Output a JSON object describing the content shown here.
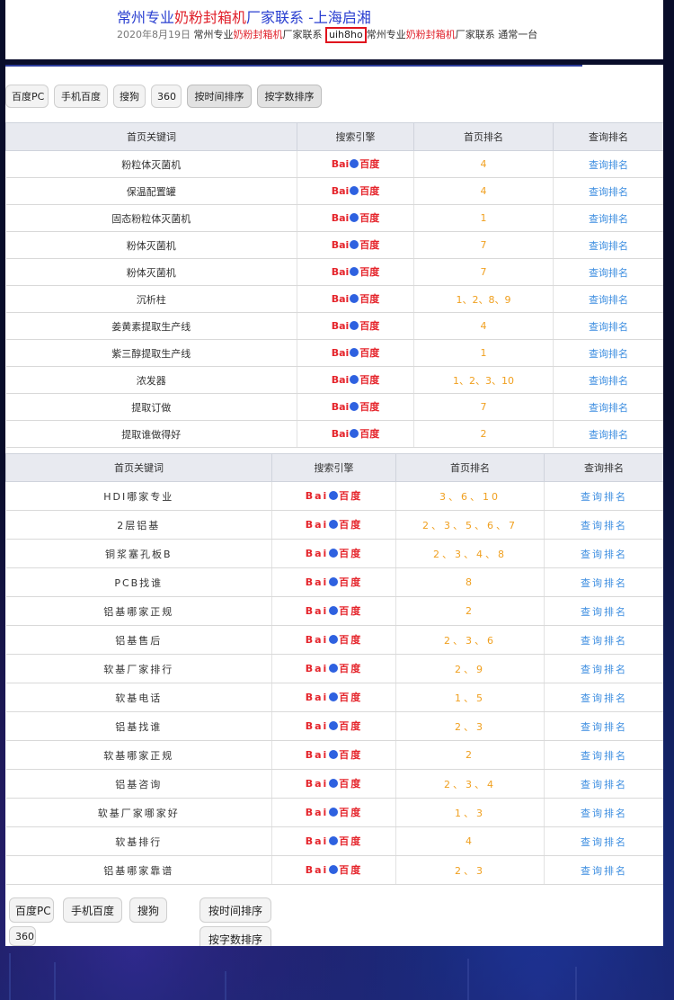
{
  "search_result": {
    "title_prefix": "常州专业",
    "title_highlight": "奶粉封箱机",
    "title_suffix": "厂家联系 -上海启湘",
    "meta_date": "2020年8月19日",
    "meta_part1": "常州专业",
    "meta_hl1": "奶粉封箱机",
    "meta_part2": "厂家联系",
    "meta_code": "uih8ho",
    "meta_part3": "常州专业",
    "meta_hl2": "奶粉封箱机",
    "meta_part4": "厂家联系 通常一台"
  },
  "filters_top": {
    "baidu_pc": "百度PC",
    "mobile_baidu": "手机百度",
    "sogou": "搜狗",
    "s360": "360",
    "sort_time": "按时间排序",
    "sort_words": "按字数排序"
  },
  "table_headers": {
    "keyword": "首页关键词",
    "engine": "搜索引擎",
    "rank": "首页排名",
    "query": "查询排名"
  },
  "baidu_logo": {
    "text_left": "Bai",
    "text_right": "百度",
    "paw": "paw-icon"
  },
  "table1_rows": [
    {
      "keyword": "粉粒体灭菌机",
      "rank": "4",
      "query": "查询排名"
    },
    {
      "keyword": "保温配置罐",
      "rank": "4",
      "query": "查询排名"
    },
    {
      "keyword": "固态粉粒体灭菌机",
      "rank": "1",
      "query": "查询排名"
    },
    {
      "keyword": "粉体灭菌机",
      "rank": "7",
      "query": "查询排名"
    },
    {
      "keyword": "粉体灭菌机",
      "rank": "7",
      "query": "查询排名"
    },
    {
      "keyword": "沉析柱",
      "rank": "1、2、8、9",
      "query": "查询排名"
    },
    {
      "keyword": "姜黄素提取生产线",
      "rank": "4",
      "query": "查询排名"
    },
    {
      "keyword": "紫三醇提取生产线",
      "rank": "1",
      "query": "查询排名"
    },
    {
      "keyword": "浓发器",
      "rank": "1、2、3、10",
      "query": "查询排名"
    },
    {
      "keyword": "提取订做",
      "rank": "7",
      "query": "查询排名"
    },
    {
      "keyword": "提取谁做得好",
      "rank": "2",
      "query": "查询排名"
    }
  ],
  "table2_rows": [
    {
      "keyword": "HDI哪家专业",
      "rank": "3、6、10",
      "query": "查询排名"
    },
    {
      "keyword": "2层铝基",
      "rank": "2、3、5、6、7",
      "query": "查询排名"
    },
    {
      "keyword": "铜浆塞孔板B",
      "rank": "2、3、4、8",
      "query": "查询排名"
    },
    {
      "keyword": "PCB找谁",
      "rank": "8",
      "query": "查询排名"
    },
    {
      "keyword": "铝基哪家正规",
      "rank": "2",
      "query": "查询排名"
    },
    {
      "keyword": "铝基售后",
      "rank": "2、3、6",
      "query": "查询排名"
    },
    {
      "keyword": "软基厂家排行",
      "rank": "2、9",
      "query": "查询排名"
    },
    {
      "keyword": "软基电话",
      "rank": "1、5",
      "query": "查询排名"
    },
    {
      "keyword": "铝基找谁",
      "rank": "2、3",
      "query": "查询排名"
    },
    {
      "keyword": "软基哪家正规",
      "rank": "2",
      "query": "查询排名"
    },
    {
      "keyword": "铝基咨询",
      "rank": "2、3、4",
      "query": "查询排名"
    },
    {
      "keyword": "软基厂家哪家好",
      "rank": "1、3",
      "query": "查询排名"
    },
    {
      "keyword": "软基排行",
      "rank": "4",
      "query": "查询排名"
    },
    {
      "keyword": "铝基哪家靠谱",
      "rank": "2、3",
      "query": "查询排名"
    }
  ],
  "filters_bottom": {
    "baidu_pc": "百度PC",
    "mobile_baidu": "手机百度",
    "sogou": "搜狗",
    "sort_time": "按时间排序",
    "s360": "360",
    "sort_words": "按字数排序"
  },
  "colors": {
    "link_blue": "#3d8ee0",
    "rank_orange": "#f0a020",
    "highlight_red": "#e0202a"
  }
}
